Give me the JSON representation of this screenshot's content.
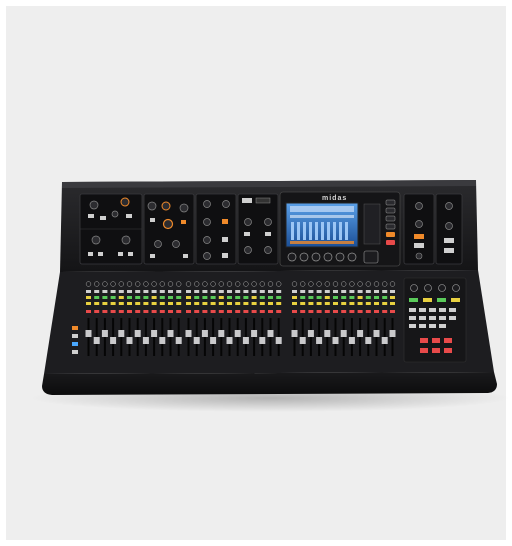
{
  "image": {
    "subject": "digital-mixing-console",
    "background_color": "#eeeeee"
  },
  "console": {
    "brand_wordmark": "midas",
    "accent_colors": {
      "orange": "#f08a2a",
      "red": "#e84a4a",
      "yellow": "#e8d040",
      "green": "#5acb5a",
      "blue": "#4aa8ff",
      "screen_blue": "#2a6ab8"
    }
  }
}
